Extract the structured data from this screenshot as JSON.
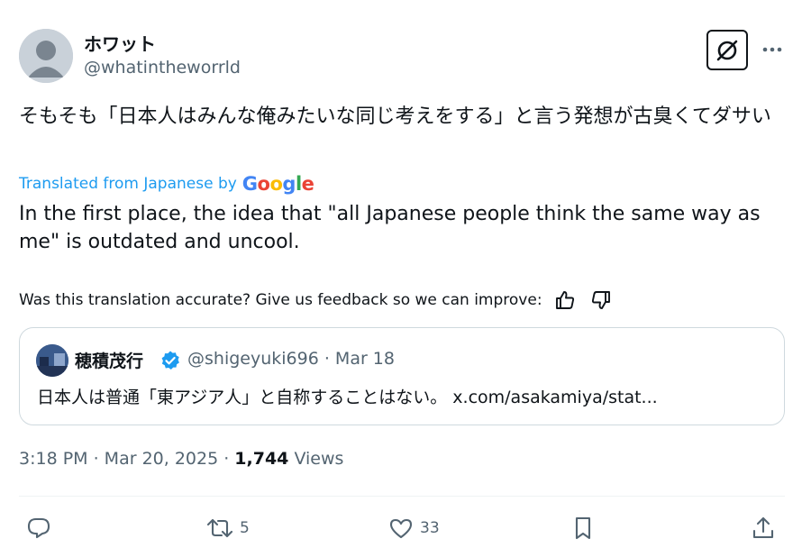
{
  "author": {
    "display_name": "ホワット",
    "handle": "@whatintheworrld"
  },
  "tweet": {
    "text": "そもそも「日本人はみんな俺みたいな同じ考えをする」と言う発想が古臭くてダサい",
    "translated_label": "Translated from Japanese by",
    "translation_provider": "Google",
    "translation": "In the first place, the idea that \"all Japanese people think the same way as me\" is outdated and uncool.",
    "feedback_prompt": "Was this translation accurate? Give us feedback so we can improve:"
  },
  "quoted_tweet": {
    "display_name": "穂積茂行",
    "handle_and_date": "@shigeyuki696 · Mar 18",
    "text": "日本人は普通「東アジア人」と自称することはない。 x.com/asakamiya/stat..."
  },
  "meta": {
    "time_date": "3:18 PM · Mar 20, 2025 · ",
    "views_count": "1,744",
    "views_label": " Views"
  },
  "actions": {
    "reposts": "5",
    "likes": "33"
  },
  "colors": {
    "link_blue": "#1d9bf0",
    "secondary_text": "#536471",
    "primary_text": "#0f1419",
    "border": "#cfd9de",
    "verified": "#1d9bf0"
  },
  "icons": [
    "grok-icon",
    "more-icon",
    "thumbs-up-icon",
    "thumbs-down-icon",
    "verified-badge-icon",
    "reply-icon",
    "repost-icon",
    "like-icon",
    "bookmark-icon",
    "share-icon"
  ]
}
